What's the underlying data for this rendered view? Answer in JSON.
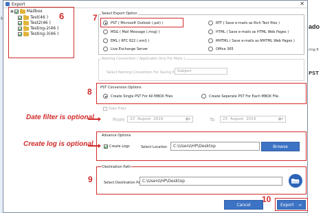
{
  "window": {
    "title": "Export"
  },
  "tree": {
    "root_label": "Mailbox",
    "items": [
      {
        "label": "Test(46 )"
      },
      {
        "label": "Test2(46 )"
      },
      {
        "label": "Testing-2(46 )"
      },
      {
        "label": "Testing-3(46 )"
      }
    ]
  },
  "export_option": {
    "group_label": "Select Export Option",
    "options": [
      "PST ( Microsoft Outlook (.pst) )",
      "RTF ( Save e-mails as Rich Text files )",
      "MSG ( Mail Message (.msg) )",
      "HTML ( Save e-mails as HTML Web Pages )",
      "EML ( RFC 822 (.eml) )",
      "MHTML ( Save e-mails as MHTML Web Pages )",
      "Live Exchange Server",
      "Office 365"
    ],
    "selected": "PST ( Microsoft Outlook (.pst) )"
  },
  "naming": {
    "group_label": "Naming Convention ( Applicable Only For Mails )",
    "label": "Select Naming Convention For Saving Mails",
    "value": "Subject"
  },
  "pst_conversion": {
    "group_label": "PST Conversion Options",
    "option_single": "Create Single PST For All MBOX Files",
    "option_separate": "Create Seperate PST For Each MBOX File."
  },
  "date_filter": {
    "checkbox_label": "Date Filter",
    "from_label": "From",
    "to_label": "To",
    "from_day": "23",
    "from_month": "August",
    "from_year": "2019",
    "to_day": "23",
    "to_month": "August",
    "to_year": "2019"
  },
  "advance": {
    "group_label": "Advance Options",
    "create_logs_label": "Create Logs",
    "location_label": "Select Location",
    "location_value": "C:\\Users\\HP\\Desktop",
    "browse_label": "Browse"
  },
  "destination": {
    "group_label": "Destination Path",
    "label": "Select Destination Path",
    "value": "C:\\Users\\HP\\Desktop"
  },
  "buttons": {
    "cancel": "Cancel",
    "export": "Export"
  },
  "annotations": {
    "n6": "6",
    "n7": "7",
    "n8": "8",
    "n9": "9",
    "n10": "10",
    "date_filter_note": "Date filter is optional",
    "create_log_note": "Create log is optional"
  },
  "background_fragments": {
    "left_top": "M",
    "right_ado": "ado",
    "right_ring": "ring fi",
    "right_pst": "PST"
  },
  "colors": {
    "accent_blue": "#3d73c4",
    "annotation_red": "#d12a2a"
  }
}
